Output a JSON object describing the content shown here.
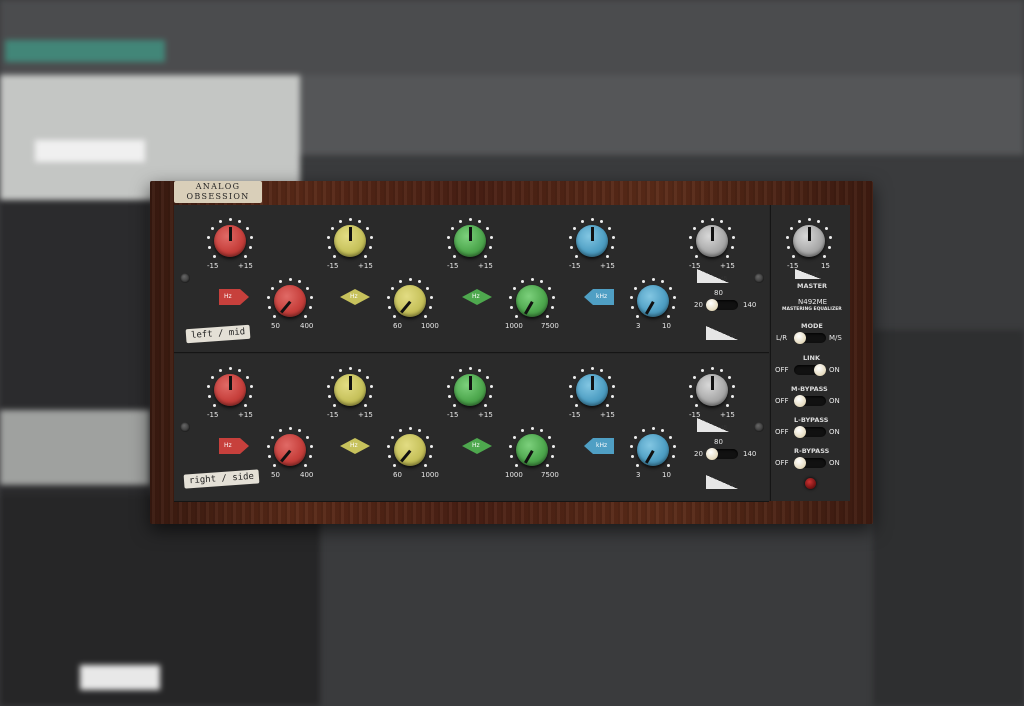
{
  "app": {
    "brand_line1": "ANALOG",
    "brand_line2": "OBSESSION"
  },
  "rows": [
    {
      "name_tag": "left / mid"
    },
    {
      "name_tag": "right / side"
    }
  ],
  "labels": {
    "gain_min": "-15",
    "gain_max": "+15",
    "band1_min": "50",
    "band1_max": "400",
    "band2_min": "60",
    "band2_max": "1000",
    "band3_min": "1000",
    "band3_max": "7500",
    "band4_min": "3",
    "band4_max": "10",
    "hz": "Hz",
    "khz": "kHz",
    "db": "dB",
    "hpf_top": "80",
    "hpf_min": "20",
    "hpf_max": "140"
  },
  "side": {
    "master_min": "-15",
    "master_max": "15",
    "master": "MASTER",
    "db": "dB",
    "model": "N492ME",
    "subtitle": "MASTERING EQUALIZER",
    "mode": "MODE",
    "mode_left": "L/R",
    "mode_right": "M/S",
    "link": "LINK",
    "m_bypass": "M-BYPASS",
    "l_bypass": "L-BYPASS",
    "r_bypass": "R-BYPASS",
    "off": "OFF",
    "on": "ON"
  },
  "colors": {
    "red": "#c7403c",
    "yellow": "#c7c25c",
    "green": "#4ea84e",
    "blue": "#4f9fc4",
    "gray": "#aaaaaa",
    "wood": "#4a2014"
  }
}
